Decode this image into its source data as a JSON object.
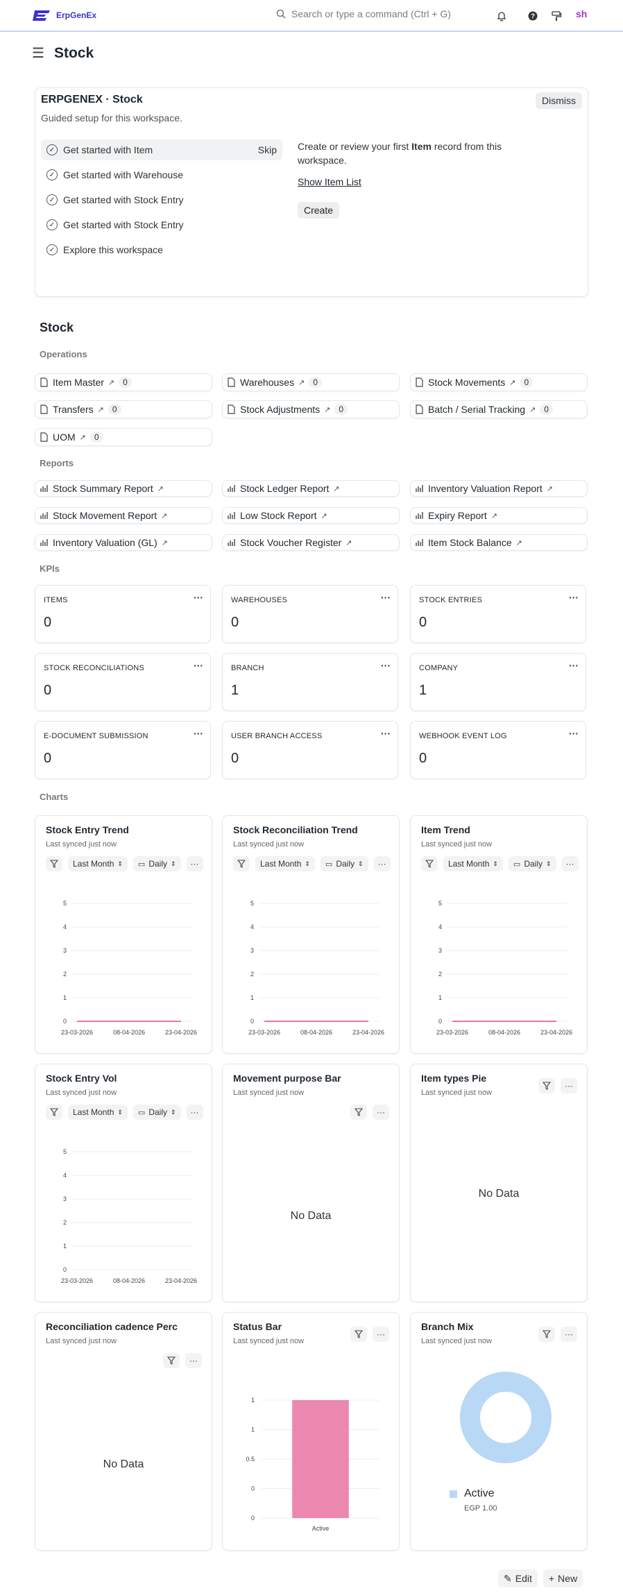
{
  "topbar": {
    "brand": "ErpGenEx",
    "search_placeholder": "Search or type a command (Ctrl + G)",
    "avatar": "sh",
    "icons": [
      "bell-icon",
      "help-icon",
      "brush-icon"
    ]
  },
  "page": {
    "title": "Stock"
  },
  "onboarding": {
    "title": "ERPGENEX · Stock",
    "subtitle": "Guided setup for this workspace.",
    "dismiss": "Dismiss",
    "steps": [
      {
        "label": "Get started with Item",
        "skip": "Skip",
        "active": true
      },
      {
        "label": "Get started with Warehouse"
      },
      {
        "label": "Get started with Stock Entry"
      },
      {
        "label": "Get started with Stock Entry"
      },
      {
        "label": "Explore this workspace"
      }
    ],
    "detail_pre": "Create or review your first ",
    "detail_bold": "Item",
    "detail_post": " record from this workspace.",
    "link": "Show Item List",
    "create": "Create"
  },
  "workspace": {
    "heading": "Stock",
    "operations_label": "Operations",
    "operations": [
      {
        "label": "Item Master",
        "count": "0"
      },
      {
        "label": "Warehouses",
        "count": "0"
      },
      {
        "label": "Stock Movements",
        "count": "0"
      },
      {
        "label": "Transfers",
        "count": "0"
      },
      {
        "label": "Stock Adjustments",
        "count": "0"
      },
      {
        "label": "Batch / Serial Tracking",
        "count": "0"
      },
      {
        "label": "UOM",
        "count": "0"
      }
    ],
    "reports_label": "Reports",
    "reports": [
      {
        "label": "Stock Summary Report"
      },
      {
        "label": "Stock Ledger Report"
      },
      {
        "label": "Inventory Valuation Report"
      },
      {
        "label": "Stock Movement Report"
      },
      {
        "label": "Low Stock Report"
      },
      {
        "label": "Expiry Report"
      },
      {
        "label": "Inventory Valuation (GL)"
      },
      {
        "label": "Stock Voucher Register"
      },
      {
        "label": "Item Stock Balance"
      }
    ],
    "kpis_label": "KPIs",
    "kpis": [
      {
        "label": "ITEMS",
        "value": "0"
      },
      {
        "label": "WAREHOUSES",
        "value": "0"
      },
      {
        "label": "STOCK ENTRIES",
        "value": "0"
      },
      {
        "label": "STOCK RECONCILIATIONS",
        "value": "0"
      },
      {
        "label": "BRANCH",
        "value": "1"
      },
      {
        "label": "COMPANY",
        "value": "1"
      },
      {
        "label": "E-DOCUMENT SUBMISSION",
        "value": "0"
      },
      {
        "label": "USER BRANCH ACCESS",
        "value": "0"
      },
      {
        "label": "WEBHOOK EVENT LOG",
        "value": "0"
      }
    ],
    "charts_label": "Charts"
  },
  "charts": {
    "synced": "Last synced just now",
    "range": "Last Month",
    "interval": "Daily",
    "no_data": "No Data",
    "cards": [
      {
        "title": "Stock Entry Trend"
      },
      {
        "title": "Stock Reconciliation Trend"
      },
      {
        "title": "Item Trend"
      },
      {
        "title": "Stock Entry Vol"
      },
      {
        "title": "Movement purpose Bar"
      },
      {
        "title": "Item types Pie"
      },
      {
        "title": "Reconciliation cadence Perc"
      },
      {
        "title": "Status Bar"
      },
      {
        "title": "Branch Mix"
      }
    ]
  },
  "chart_data": [
    {
      "type": "line",
      "title": "Stock Entry Trend",
      "x": [
        "23-03-2026",
        "08-04-2026",
        "23-04-2026"
      ],
      "yticks": [
        0,
        1,
        2,
        3,
        4,
        5
      ],
      "ylim": [
        0,
        5
      ],
      "series": [
        {
          "values": [
            0,
            0,
            0
          ],
          "color": "#e8456e"
        }
      ]
    },
    {
      "type": "line",
      "title": "Stock Reconciliation Trend",
      "x": [
        "23-03-2026",
        "08-04-2026",
        "23-04-2026"
      ],
      "yticks": [
        0,
        1,
        2,
        3,
        4,
        5
      ],
      "ylim": [
        0,
        5
      ],
      "series": [
        {
          "values": [
            0,
            0,
            0
          ],
          "color": "#e8456e"
        }
      ]
    },
    {
      "type": "line",
      "title": "Item Trend",
      "x": [
        "23-03-2026",
        "08-04-2026",
        "23-04-2026"
      ],
      "yticks": [
        0,
        1,
        2,
        3,
        4,
        5
      ],
      "ylim": [
        0,
        5
      ],
      "series": [
        {
          "values": [
            0,
            0,
            0
          ],
          "color": "#e8456e"
        }
      ]
    },
    {
      "type": "line",
      "title": "Stock Entry Vol",
      "x": [
        "23-03-2026",
        "08-04-2026",
        "23-04-2026"
      ],
      "yticks": [
        0,
        1,
        2,
        3,
        4,
        5
      ],
      "ylim": [
        0,
        5
      ],
      "series": []
    },
    {
      "type": "bar",
      "title": "Status Bar",
      "categories": [
        "Active"
      ],
      "values": [
        1
      ],
      "ytick_labels": [
        "0",
        "0",
        "0.5",
        "1",
        "1"
      ],
      "ylim": [
        0,
        1
      ],
      "color": "#ec87b0"
    },
    {
      "type": "pie",
      "title": "Branch Mix",
      "labels": [
        "Active"
      ],
      "values": [
        1
      ],
      "value_labels": [
        "EGP 1.00"
      ],
      "color": "#b9d8f5"
    }
  ],
  "footer": {
    "edit": "Edit",
    "new": "New"
  }
}
